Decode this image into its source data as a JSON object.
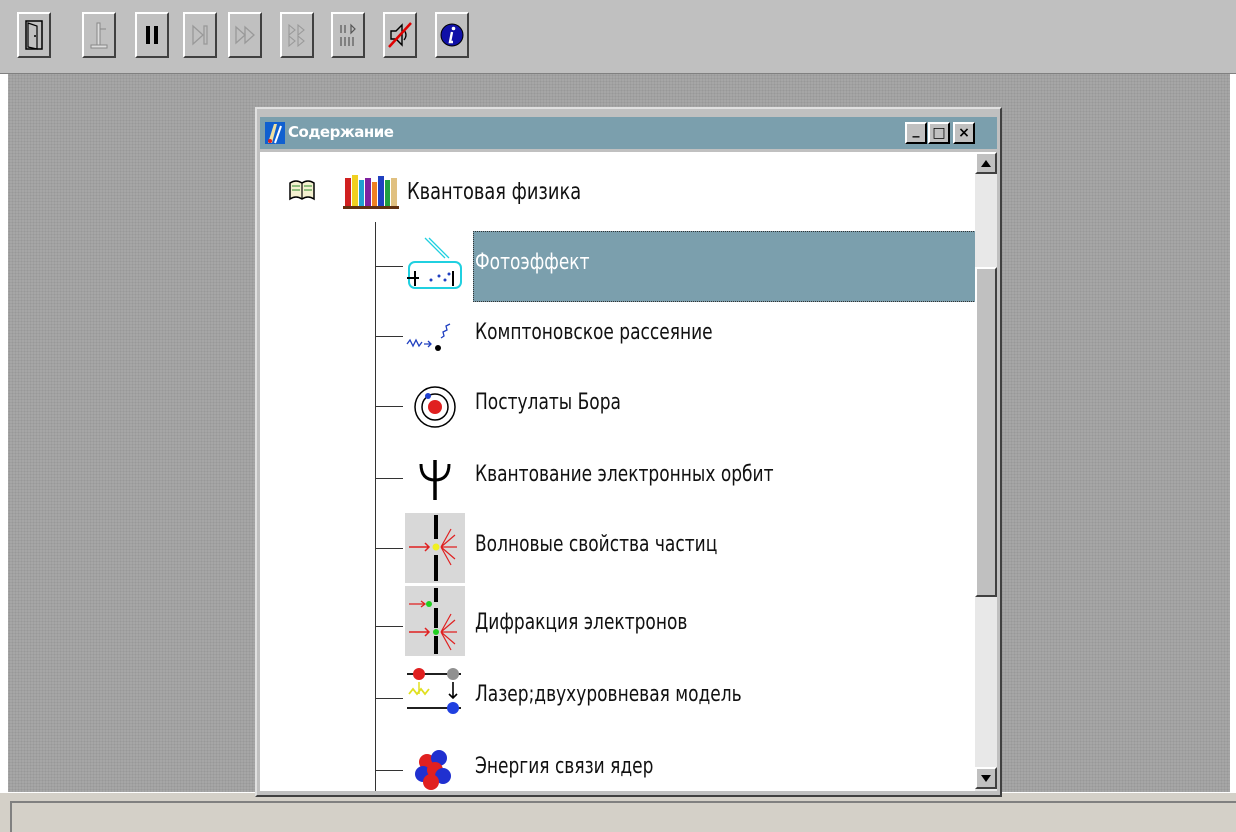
{
  "toolbar": {
    "buttons": [
      {
        "name": "exit",
        "icon": "door-icon"
      },
      {
        "name": "experiment",
        "icon": "flask-stand-icon"
      },
      {
        "name": "pause",
        "icon": "pause-icon"
      },
      {
        "name": "step",
        "icon": "step-forward-icon"
      },
      {
        "name": "fast-forward",
        "icon": "fast-forward-icon"
      },
      {
        "name": "double-step",
        "icon": "double-step-icon"
      },
      {
        "name": "frames",
        "icon": "frames-icon"
      },
      {
        "name": "sound",
        "icon": "sound-off-icon"
      },
      {
        "name": "info",
        "icon": "info-icon"
      }
    ]
  },
  "window": {
    "title": "Содержание",
    "minimize": "_",
    "maximize": "□",
    "close": "×"
  },
  "tree": {
    "root": {
      "label": "Квантовая физика",
      "icon": "bookshelf-icon",
      "state_icon": "open-book-icon"
    },
    "items": [
      {
        "label": "Фотоэффект",
        "icon": "photoeffect-icon",
        "selected": true
      },
      {
        "label": "Комптоновское рассеяние",
        "icon": "compton-scattering-icon",
        "selected": false
      },
      {
        "label": "Постулаты Бора",
        "icon": "bohr-atom-icon",
        "selected": false
      },
      {
        "label": "Квантование электронных орбит",
        "icon": "psi-icon",
        "selected": false
      },
      {
        "label": "Волновые свойства частиц",
        "icon": "wave-particle-icon",
        "selected": false
      },
      {
        "label": "Дифракция электронов",
        "icon": "electron-diffraction-icon",
        "selected": false
      },
      {
        "label": "Лазер;двухуровневая модель",
        "icon": "laser-two-level-icon",
        "selected": false
      },
      {
        "label": "Энергия связи ядер",
        "icon": "nucleus-icon",
        "selected": false
      }
    ]
  },
  "colors": {
    "titlebar": "#7b9fad",
    "selection": "#7b9fad",
    "desktop": "#a6a6a6"
  }
}
